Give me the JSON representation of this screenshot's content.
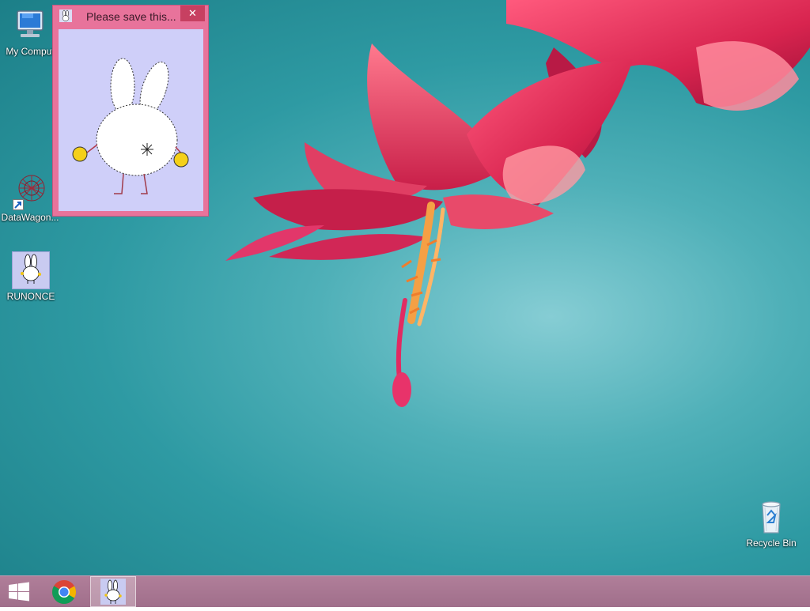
{
  "desktop": {
    "icons": [
      {
        "label": "My Comput",
        "icon": "computer-icon"
      },
      {
        "label": "DataWagon...",
        "icon": "web-network-icon"
      },
      {
        "label": "RUNONCE",
        "icon": "bunny-icon"
      },
      {
        "label": "Recycle Bin",
        "icon": "recycle-bin-icon"
      }
    ]
  },
  "window": {
    "title": "Please save this...",
    "close_glyph": "✕",
    "titlebar_color": "#e8739b",
    "client_color": "#cfcff9",
    "content": "bunny-drawing"
  },
  "taskbar": {
    "color": "#a97794",
    "items": [
      {
        "name": "start",
        "icon": "windows-logo-icon"
      },
      {
        "name": "chrome",
        "icon": "chrome-icon"
      },
      {
        "name": "runonce",
        "icon": "bunny-icon",
        "active": true
      }
    ]
  },
  "wallpaper": {
    "subject": "flower",
    "colors": {
      "sky": "#3fa6ae",
      "petal": "#e0345e",
      "stamen": "#f08a3c"
    }
  }
}
